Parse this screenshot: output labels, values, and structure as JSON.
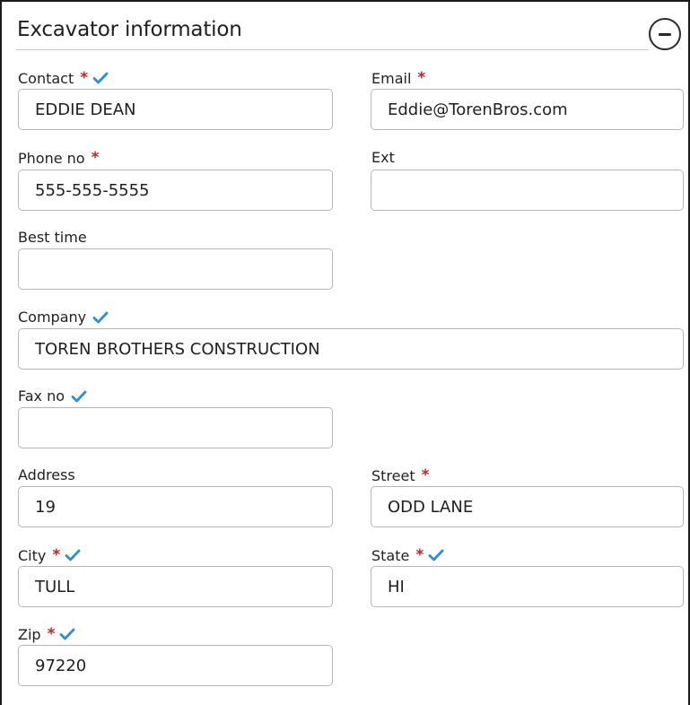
{
  "section": {
    "title": "Excavator information",
    "collapse_icon": "minus-circle-icon"
  },
  "colors": {
    "required": "#c0272d",
    "verified": "#2b8fd8",
    "input_border": "#b7b7b7"
  },
  "fields": {
    "contact": {
      "label": "Contact",
      "value": "EDDIE DEAN",
      "required": true,
      "verified": true
    },
    "email": {
      "label": "Email",
      "value": "Eddie@TorenBros.com",
      "required": true,
      "verified": false
    },
    "phone": {
      "label": "Phone no",
      "value": "555-555-5555",
      "required": true,
      "verified": false
    },
    "ext": {
      "label": "Ext",
      "value": "",
      "required": false,
      "verified": false
    },
    "best_time": {
      "label": "Best time",
      "value": "",
      "required": false,
      "verified": false
    },
    "company": {
      "label": "Company",
      "value": "TOREN BROTHERS CONSTRUCTION",
      "required": false,
      "verified": true
    },
    "fax": {
      "label": "Fax no",
      "value": "",
      "required": false,
      "verified": true
    },
    "address": {
      "label": "Address",
      "value": "19",
      "required": false,
      "verified": false
    },
    "street": {
      "label": "Street",
      "value": "ODD LANE",
      "required": true,
      "verified": false
    },
    "city": {
      "label": "City",
      "value": "TULL",
      "required": true,
      "verified": true
    },
    "state": {
      "label": "State",
      "value": "HI",
      "required": true,
      "verified": true
    },
    "zip": {
      "label": "Zip",
      "value": "97220",
      "required": true,
      "verified": true
    }
  },
  "required_marker": "*"
}
